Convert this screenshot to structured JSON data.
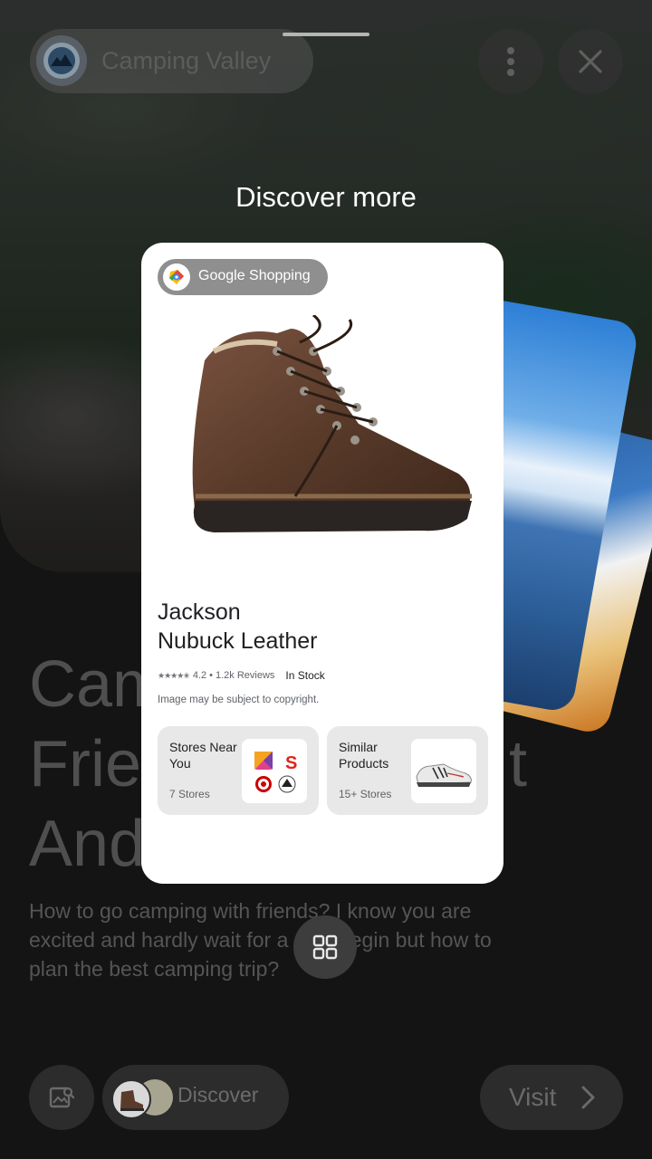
{
  "header": {
    "site_name": "Camping Valley"
  },
  "overlay": {
    "heading": "Discover more"
  },
  "card": {
    "source_label": "Google Shopping",
    "product_name_line1": "Jackson",
    "product_name_line2": "Nubuck Leather",
    "rating": "4.2",
    "rating_stars": 4.5,
    "reviews": "1.2k Reviews",
    "separator": "•",
    "stock": "In Stock",
    "copyright": "Image may be subject to copyright.",
    "tiles": [
      {
        "title": "Stores Near You",
        "subtitle": "7 Stores"
      },
      {
        "title": "Similar Products",
        "subtitle": "15+ Stores"
      }
    ]
  },
  "article": {
    "title_lines": [
      "Cam",
      "Frie",
      "And"
    ],
    "title_tail": "t",
    "body_line1": "How to go camping with friends? I know you are",
    "body_line2_left": "excited and hardly wait for a",
    "body_line2_right": "to begin but how to",
    "body_line3": "plan the best camping trip?"
  },
  "bottom_bar": {
    "discover_label": "Discover",
    "visit_label": "Visit"
  },
  "colors": {
    "card_bg": "#ffffff",
    "pill_bg": "#8f8f8f",
    "tile_bg": "#e8e8e8",
    "boot_brown": "#5a3b2a"
  },
  "icons": [
    "site-logo-icon",
    "more-vert-icon",
    "close-icon",
    "google-shopping-icon",
    "grid-icon",
    "image-search-icon",
    "chevron-right-icon"
  ]
}
